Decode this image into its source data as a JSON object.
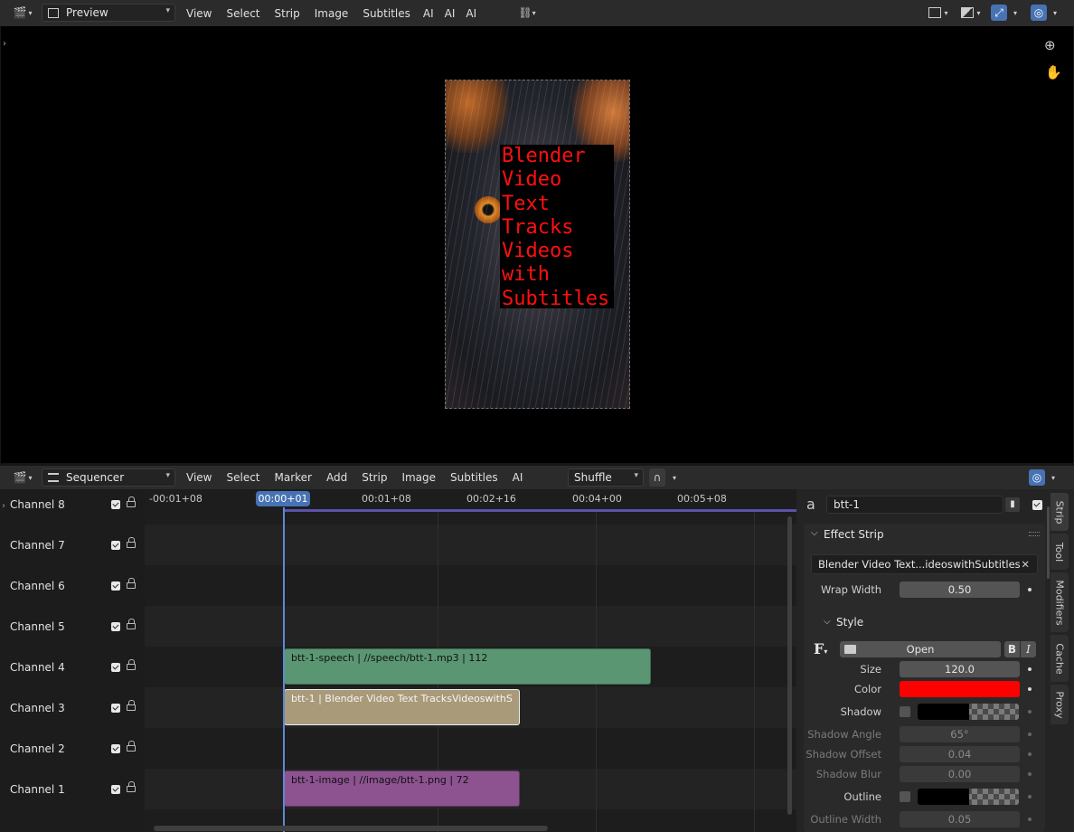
{
  "top_header": {
    "editor_type": "Preview",
    "menus": [
      "View",
      "Select",
      "Strip",
      "Image",
      "Subtitles",
      "AI",
      "AI",
      "AI"
    ]
  },
  "preview": {
    "text_lines": [
      "Blender",
      "Video",
      "Text",
      "Tracks",
      "Videos",
      "with",
      "Subtitles"
    ]
  },
  "seq_header": {
    "editor_type": "Sequencer",
    "menus": [
      "View",
      "Select",
      "Marker",
      "Add",
      "Strip",
      "Image",
      "Subtitles",
      "AI"
    ],
    "overlap_mode": "Shuffle"
  },
  "timeline": {
    "ticks": [
      "-00:01+08",
      "00:01+08",
      "00:02+16",
      "00:04+00",
      "00:05+08"
    ],
    "current_frame": "00:00+01"
  },
  "channels": [
    "Channel 8",
    "Channel 7",
    "Channel 6",
    "Channel 5",
    "Channel 4",
    "Channel 3",
    "Channel 2",
    "Channel 1"
  ],
  "strips": [
    {
      "label": "btt-1-speech | //speech/btt-1.mp3 | 112",
      "channel": 4,
      "color": "#5a9672"
    },
    {
      "label": "btt-1 | Blender Video Text TracksVideoswithS",
      "channel": 3,
      "color": "#a99a79"
    },
    {
      "label": "btt-1-image | //image/btt-1.png | 72",
      "channel": 1,
      "color": "#8d5290"
    }
  ],
  "props": {
    "strip_name": "btt-1",
    "section": "Effect Strip",
    "text_value": "Blender Video Text...ideoswithSubtitles",
    "wrap_width_label": "Wrap Width",
    "wrap_width": "0.50",
    "style_section": "Style",
    "open_label": "Open",
    "size_label": "Size",
    "size": "120.0",
    "color_label": "Color",
    "color": "#ff0000",
    "shadow_label": "Shadow",
    "shadow_angle_label": "Shadow Angle",
    "shadow_angle": "65°",
    "shadow_offset_label": "Shadow Offset",
    "shadow_offset": "0.04",
    "shadow_blur_label": "Shadow Blur",
    "shadow_blur": "0.00",
    "outline_label": "Outline",
    "outline_width_label": "Outline Width",
    "outline_width": "0.05"
  },
  "sidebar_tabs": [
    "Strip",
    "Tool",
    "Modifiers",
    "Cache",
    "Proxy"
  ]
}
